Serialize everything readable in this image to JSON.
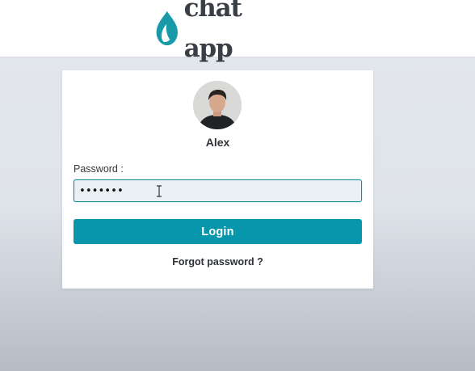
{
  "header": {
    "logo_text": "chat app",
    "logo_icon": "drop-icon",
    "brand_color": "#1a9aa8"
  },
  "login": {
    "user_name": "Alex",
    "avatar_icon": "user-avatar",
    "password_label": "Password :",
    "password_value": "•••••••",
    "login_label": "Login",
    "forgot_label": "Forgot password ?",
    "accent_color": "#0896ad"
  }
}
